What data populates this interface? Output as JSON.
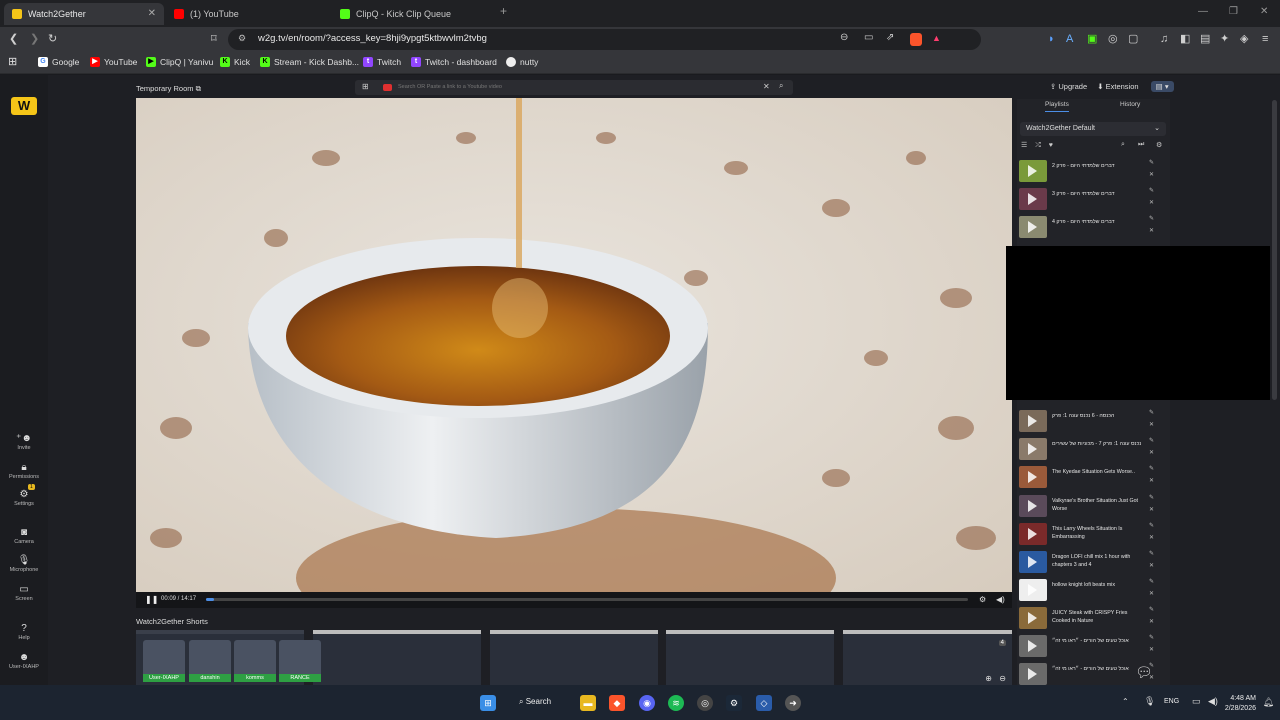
{
  "browser": {
    "tabs": [
      {
        "label": "Watch2Gether",
        "color": "#f5c518"
      },
      {
        "label": "(1) YouTube",
        "color": "#ff0000"
      },
      {
        "label": "ClipQ - Kick Clip Queue",
        "color": "#53fc18"
      }
    ],
    "url": "w2g.tv/en/room/?access_key=8hji9ypgt5ktbwvlm2tvbg",
    "bookmarks": [
      "Google",
      "YouTube",
      "ClipQ | Yanivu",
      "Kick",
      "Stream - Kick Dashb...",
      "Twitch",
      "Twitch - dashboard",
      "nutty"
    ]
  },
  "room": {
    "title": "Temporary Room",
    "search_placeholder": "Search OR Paste a link to a Youtube video",
    "upgrade_label": "Upgrade",
    "extension_label": "Extension"
  },
  "rail": {
    "logo": "W",
    "items": [
      "Invite",
      "Permissions",
      "Settings",
      "Camera",
      "Microphone",
      "Screen",
      "Help",
      "User-IXAHP"
    ],
    "settings_badge": "1"
  },
  "player": {
    "time": "00:09 / 14:17",
    "progress": 0.011
  },
  "shorts": {
    "title": "Watch2Gether Shorts",
    "users": [
      "User-IXAHP",
      "danshin",
      "komms",
      "RANCE"
    ],
    "badge": "4"
  },
  "sidebar": {
    "tab_playlists": "Playlists",
    "tab_history": "History",
    "playlist_name": "Watch2Gether Default",
    "items": [
      "2 דברים שלמדתי היום - פרק",
      "3 דברים שלמדתי היום - פרק",
      "4 דברים שלמדתי היום - פרק",
      "הכנסה - 6 נכנס עונה 1: פרק",
      "נכנס עונה 1: פרק 7 - מכוניות של עשירים",
      "The Kyedae Situation Gets Worse..",
      "Valkyrae's Brother Situation Just Got Worse",
      "This Larry Wheels Situation Is Embarrassing",
      "Dragon LOFI chill mix 1 hour with chapters 3 and 4",
      "hollow knight lofi beats mix",
      "JUICY Steak with CRISPY Fries Cooked in Nature",
      "אוכל טעים של הורים - ״ראו מי זה״",
      "אוכל טעים של הורים - ״ראו מי זה״"
    ]
  },
  "taskbar": {
    "search_label": "Search",
    "lang": "ENG",
    "time": "4:48 AM",
    "date": "2/28/2026"
  }
}
